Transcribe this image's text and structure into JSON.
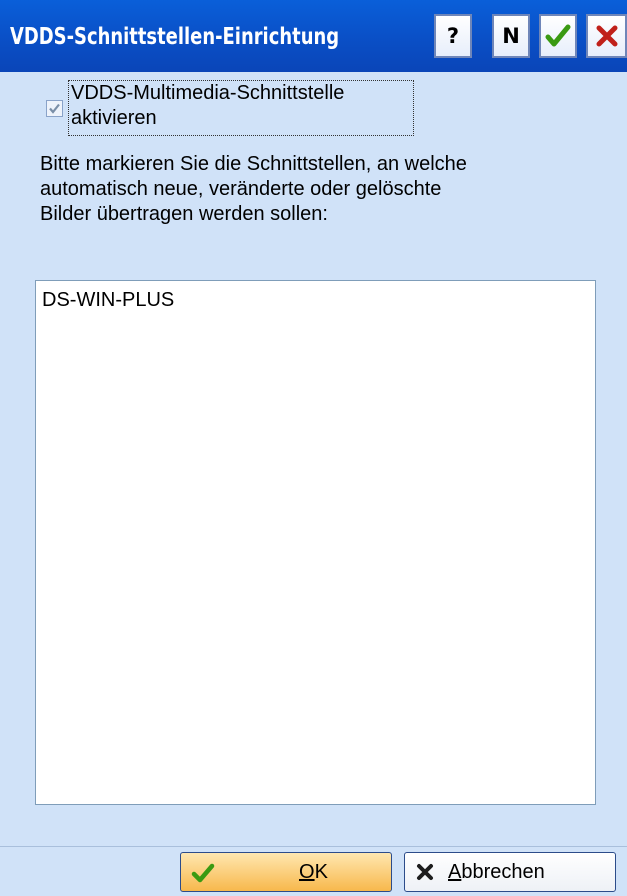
{
  "window": {
    "title": "VDDS-Schnittstellen-Einrichtung",
    "buttons": {
      "help": "?",
      "n": "N"
    }
  },
  "checkbox": {
    "line1": "VDDS-Multimedia-Schnittstelle",
    "line2": "aktivieren",
    "checked": true
  },
  "description": {
    "line1": "Bitte markieren Sie die Schnittstellen, an welche",
    "line2": "automatisch neue, veränderte oder gelöschte",
    "line3": "Bilder übertragen werden sollen:"
  },
  "list": {
    "items": [
      "DS-WIN-PLUS"
    ]
  },
  "footer": {
    "ok": {
      "mnemonic": "O",
      "rest": "K"
    },
    "cancel": {
      "mnemonic": "A",
      "rest": "bbrechen"
    }
  },
  "colors": {
    "titlebar": "#0a4fc6",
    "background": "#d0e2f8",
    "ok_accent": "#f7b84c",
    "check_green": "#3a9a12",
    "close_red": "#c0201a"
  },
  "icons": {
    "title_buttons": [
      "help-icon",
      "n-icon",
      "checkmark-icon",
      "close-icon"
    ],
    "ok": "checkmark-icon",
    "cancel": "close-icon"
  }
}
